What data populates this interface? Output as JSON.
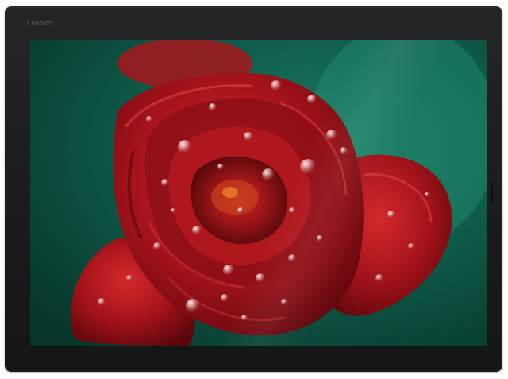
{
  "device": {
    "brand": "Lenovo",
    "bezel_color": "#1f2021"
  },
  "wallpaper": {
    "subject": "red-flower-with-water-droplets",
    "background_color": "#0f5a48",
    "flower_color": "#a3121a"
  }
}
